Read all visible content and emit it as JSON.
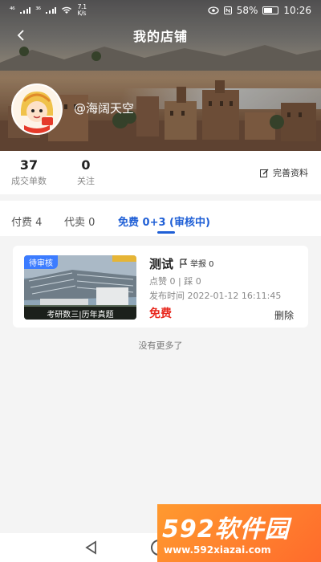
{
  "status_bar": {
    "signal_left": "⁴⁶",
    "signal_mid": "³⁶",
    "speed": "7.1 K/s",
    "battery": "58%",
    "time": "10:26"
  },
  "header": {
    "title": "我的店铺",
    "username": "@海阔天空"
  },
  "stats": {
    "deals": {
      "value": "37",
      "label": "成交单数"
    },
    "follow": {
      "value": "0",
      "label": "关注"
    },
    "edit_label": "完善资料"
  },
  "tabs": [
    {
      "label": "付费 4",
      "active": false
    },
    {
      "label": "代卖 0",
      "active": false
    },
    {
      "label": "免费 0+3 (审核中)",
      "active": true
    }
  ],
  "items": [
    {
      "badge": "待审核",
      "caption": "考研数三|历年真题",
      "title": "测试",
      "report_label": "举报 0",
      "likes_line": "点赞 0 | 踩 0",
      "time_line": "发布时间 2022-01-12 16:11:45",
      "price": "免费",
      "delete_label": "删除"
    }
  ],
  "footer_text": "没有更多了",
  "watermark": {
    "brand": "592软件园",
    "url": "www.592xiazai.com"
  },
  "colors": {
    "accent": "#1f5fd6",
    "price": "#e8281e",
    "badge": "#3c7cff",
    "watermark": "#ff7a2c"
  }
}
